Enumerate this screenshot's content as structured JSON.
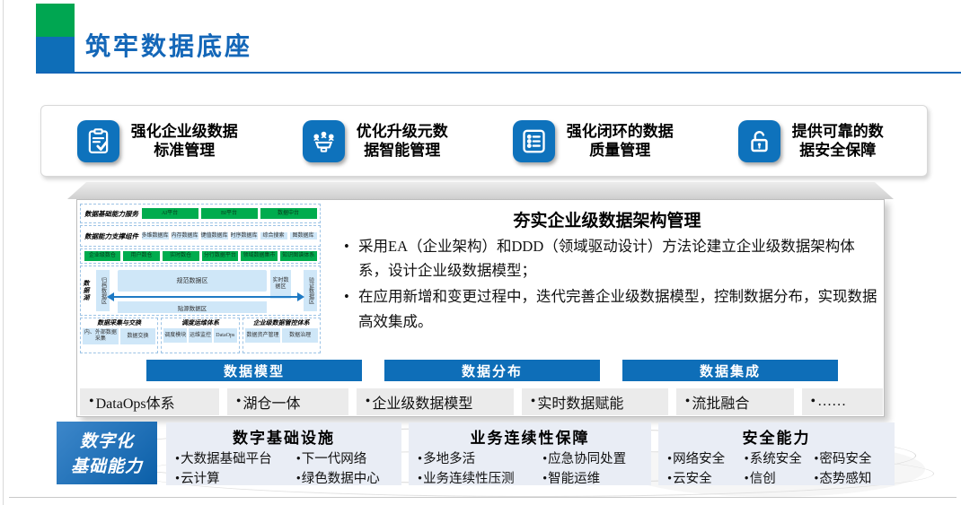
{
  "page": {
    "title": "筑牢数据底座"
  },
  "colors": {
    "accent_blue": "#0e6eb8",
    "green": "#00a651",
    "title_blue": "#1467b8"
  },
  "capabilities": {
    "items": [
      {
        "icon": "clipboard-check-icon",
        "line1": "强化企业级数据",
        "line2": "标准管理"
      },
      {
        "icon": "meeting-icon",
        "line1": "优化升级元数",
        "line2": "据智能管理"
      },
      {
        "icon": "checklist-icon",
        "line1": "强化闭环的数据",
        "line2": "质量管理"
      },
      {
        "icon": "lock-icon",
        "line1": "提供可靠的数",
        "line2": "据安全保障"
      }
    ]
  },
  "architecture": {
    "title": "夯实企业级数据架构管理",
    "bullets": [
      "采用EA（企业架构）和DDD（领域驱动设计）方法论建立企业级数据架构体系，设计企业级数据模型；",
      "在应用新增和变更过程中，迭代完善企业级数据模型，控制数据分布，实现数据高效集成。"
    ]
  },
  "diagram": {
    "services": {
      "label": "数据基础能力服务",
      "items": [
        "AI平台",
        "BI平台",
        "数据中台"
      ]
    },
    "components": {
      "label": "数据能力支撑组件",
      "items": [
        "多维数据库",
        "内存数据库",
        "键值数据库",
        "时序数据库",
        "综合搜索",
        "图数据库"
      ]
    },
    "warehouses": [
      "企业级数仓",
      "用户数仓",
      "实时数仓",
      "分行数据平台",
      "领域数据集市",
      "知识图谱体系"
    ],
    "lake": {
      "label": "数据湖",
      "archive": "归档数据区",
      "standard": "规范数据区",
      "source": "贴源数据区",
      "realtime": "实时数据区",
      "verify": "验证数据区"
    },
    "governance": [
      {
        "title": "数据采集与交换",
        "items": [
          "内、外部数据采集",
          "数据交换"
        ]
      },
      {
        "title": "调度运维体系",
        "items": [
          "调度模块",
          "运维监控",
          "DataOps"
        ]
      },
      {
        "title": "企业级数据管控体系",
        "items": [
          "数据资产管理",
          "数据治理"
        ]
      }
    ]
  },
  "bars": [
    "数据模型",
    "数据分布",
    "数据集成"
  ],
  "pills": [
    "DataOps体系",
    "湖仓一体",
    "企业级数据模型",
    "实时数据赋能",
    "流批融合",
    "……"
  ],
  "foundation": {
    "label_line1": "数字化",
    "label_line2": "基础能力",
    "groups": [
      {
        "title": "数字基础设施",
        "items": [
          "大数据基础平台",
          "下一代网络",
          "云计算",
          "绿色数据中心"
        ]
      },
      {
        "title": "业务连续性保障",
        "items": [
          "多地多活",
          "应急协同处置",
          "业务连续性压测",
          "智能运维"
        ]
      },
      {
        "title": "安全能力",
        "items": [
          "网络安全",
          "系统安全",
          "密码安全",
          "云安全",
          "信创",
          "态势感知"
        ]
      }
    ]
  }
}
